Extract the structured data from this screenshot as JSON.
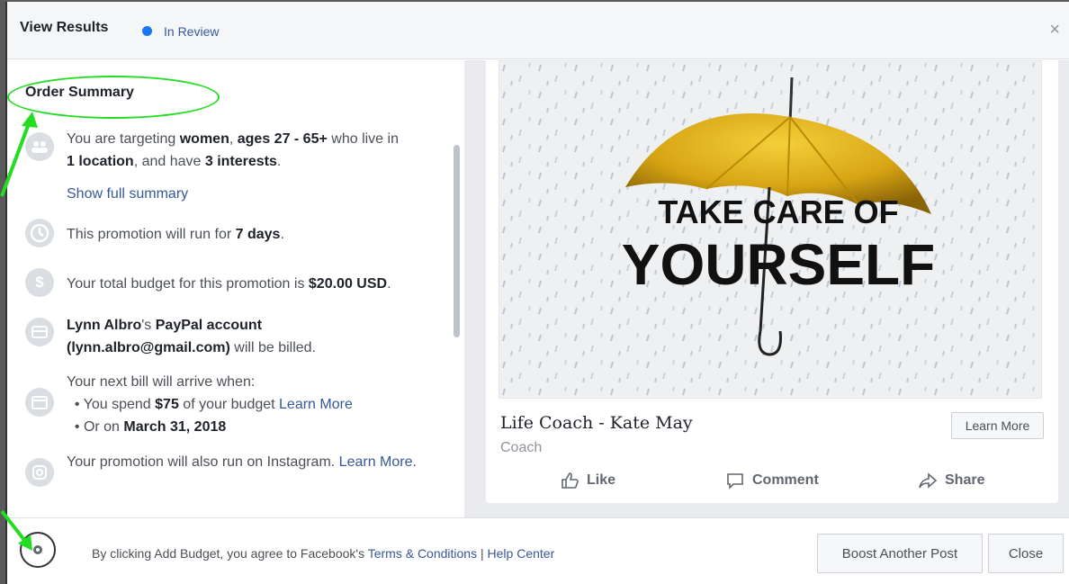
{
  "header": {
    "title": "View Results",
    "status": "In Review",
    "close_glyph": "×",
    "status_color": "#1877f2"
  },
  "summary": {
    "title": "Order Summary",
    "audience": {
      "p1": "You are targeting ",
      "b1": "women",
      "p2": ", ",
      "b2": "ages 27 - 65+",
      "p3": " who live in",
      "b3": "1 location",
      "p4": ", and have ",
      "b4": "3 interests",
      "p5": "."
    },
    "show_full_summary": "Show full summary",
    "duration": {
      "p1": "This promotion will run for ",
      "b1": "7 days",
      "p2": "."
    },
    "budget": {
      "p1": "Your total budget for this promotion is ",
      "b1": "$20.00 USD",
      "p2": "."
    },
    "billing": {
      "b1": "Lynn Albro",
      "p1": "'s ",
      "b2": "PayPal account",
      "b3": "(lynn.albro@gmail.com)",
      "p2": " will be billed."
    },
    "next_bill": {
      "intro": "Your next bill will arrive when:",
      "item1_p1": "You spend ",
      "item1_b1": "$75",
      "item1_p2": " of your budget ",
      "item1_link": "Learn More",
      "item2_p1": "Or on ",
      "item2_b1": "March 31, 2018"
    },
    "instagram": {
      "p1": "Your promotion will also run on Instagram. ",
      "link": "Learn More",
      "p2": "."
    }
  },
  "preview": {
    "image_text_line1": "TAKE CARE OF",
    "image_text_line2": "YOURSELF",
    "page_name": "Life Coach - Kate May",
    "page_category": "Coach",
    "cta_label": "Learn More",
    "actions": {
      "like": "Like",
      "comment": "Comment",
      "share": "Share"
    }
  },
  "footer": {
    "agree_text": "By clicking Add Budget, you agree to Facebook's ",
    "terms_link": "Terms & Conditions",
    "separator": " | ",
    "help_link": "Help Center",
    "boost_button": "Boost Another Post",
    "close_button": "Close"
  },
  "annotation_color": "#22dd22",
  "link_color": "#365899"
}
